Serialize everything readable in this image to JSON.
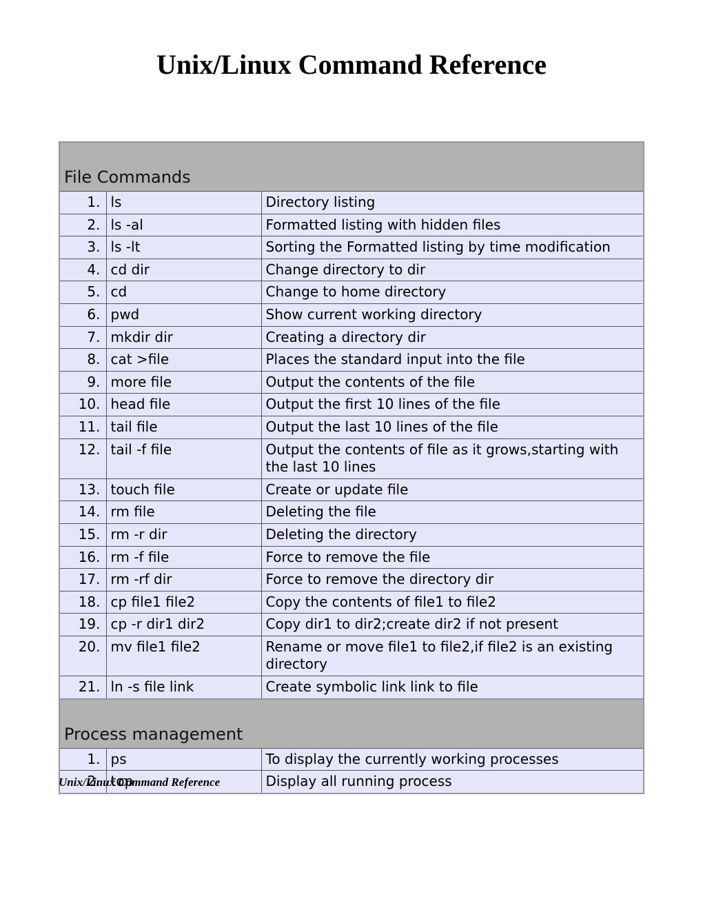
{
  "title": "Unix/Linux Command Reference",
  "footer": "Unix/Linux Command Reference",
  "sections": [
    {
      "heading": "File Commands",
      "rows": [
        {
          "n": "1.",
          "cmd": "ls",
          "desc": "Directory listing"
        },
        {
          "n": "2.",
          "cmd": "ls -al",
          "desc": "Formatted listing with hidden files"
        },
        {
          "n": "3.",
          "cmd": "ls  -lt",
          "desc": "Sorting the Formatted listing by time modification"
        },
        {
          "n": "4.",
          "cmd": "cd dir",
          "desc": "Change directory to dir"
        },
        {
          "n": "5.",
          "cmd": "cd",
          "desc": "Change to home directory"
        },
        {
          "n": "6.",
          "cmd": "pwd",
          "desc": "Show current working directory"
        },
        {
          "n": "7.",
          "cmd": "mkdir dir",
          "desc": "Creating a directory dir"
        },
        {
          "n": "8.",
          "cmd": "cat >file",
          "desc": "Places the standard input into the file"
        },
        {
          "n": "9.",
          "cmd": "more file",
          "desc": "Output the contents of the file"
        },
        {
          "n": "10.",
          "cmd": "head file",
          "desc": "Output the first 10 lines of the file"
        },
        {
          "n": "11.",
          "cmd": "tail file",
          "desc": "Output the last 10 lines of the file"
        },
        {
          "n": "12.",
          "cmd": "tail -f file",
          "desc": "Output the contents of file as it grows,starting with the last 10 lines"
        },
        {
          "n": "13.",
          "cmd": "touch file",
          "desc": "Create or update file"
        },
        {
          "n": "14.",
          "cmd": "rm file",
          "desc": "Deleting the file"
        },
        {
          "n": "15.",
          "cmd": "rm -r dir",
          "desc": "Deleting the directory"
        },
        {
          "n": "16.",
          "cmd": "rm -f file",
          "desc": "Force to remove the file"
        },
        {
          "n": "17.",
          "cmd": "rm -rf dir",
          "desc": "Force to remove the directory dir"
        },
        {
          "n": "18.",
          "cmd": "cp file1 file2",
          "desc": "Copy the contents of file1 to file2"
        },
        {
          "n": "19.",
          "cmd": "cp -r dir1 dir2",
          "desc": "Copy dir1 to dir2;create dir2 if not present"
        },
        {
          "n": "20.",
          "cmd": "mv file1 file2",
          "desc": "Rename or move file1 to file2,if file2 is an existing directory"
        },
        {
          "n": "21.",
          "cmd": "ln -s file link",
          "desc": "Create symbolic link link to file"
        }
      ]
    },
    {
      "heading": "Process management",
      "rows": [
        {
          "n": "1.",
          "cmd": "ps",
          "desc": "To display the currently working processes"
        },
        {
          "n": "2.",
          "cmd": "top",
          "desc": "Display all running process"
        }
      ]
    }
  ]
}
